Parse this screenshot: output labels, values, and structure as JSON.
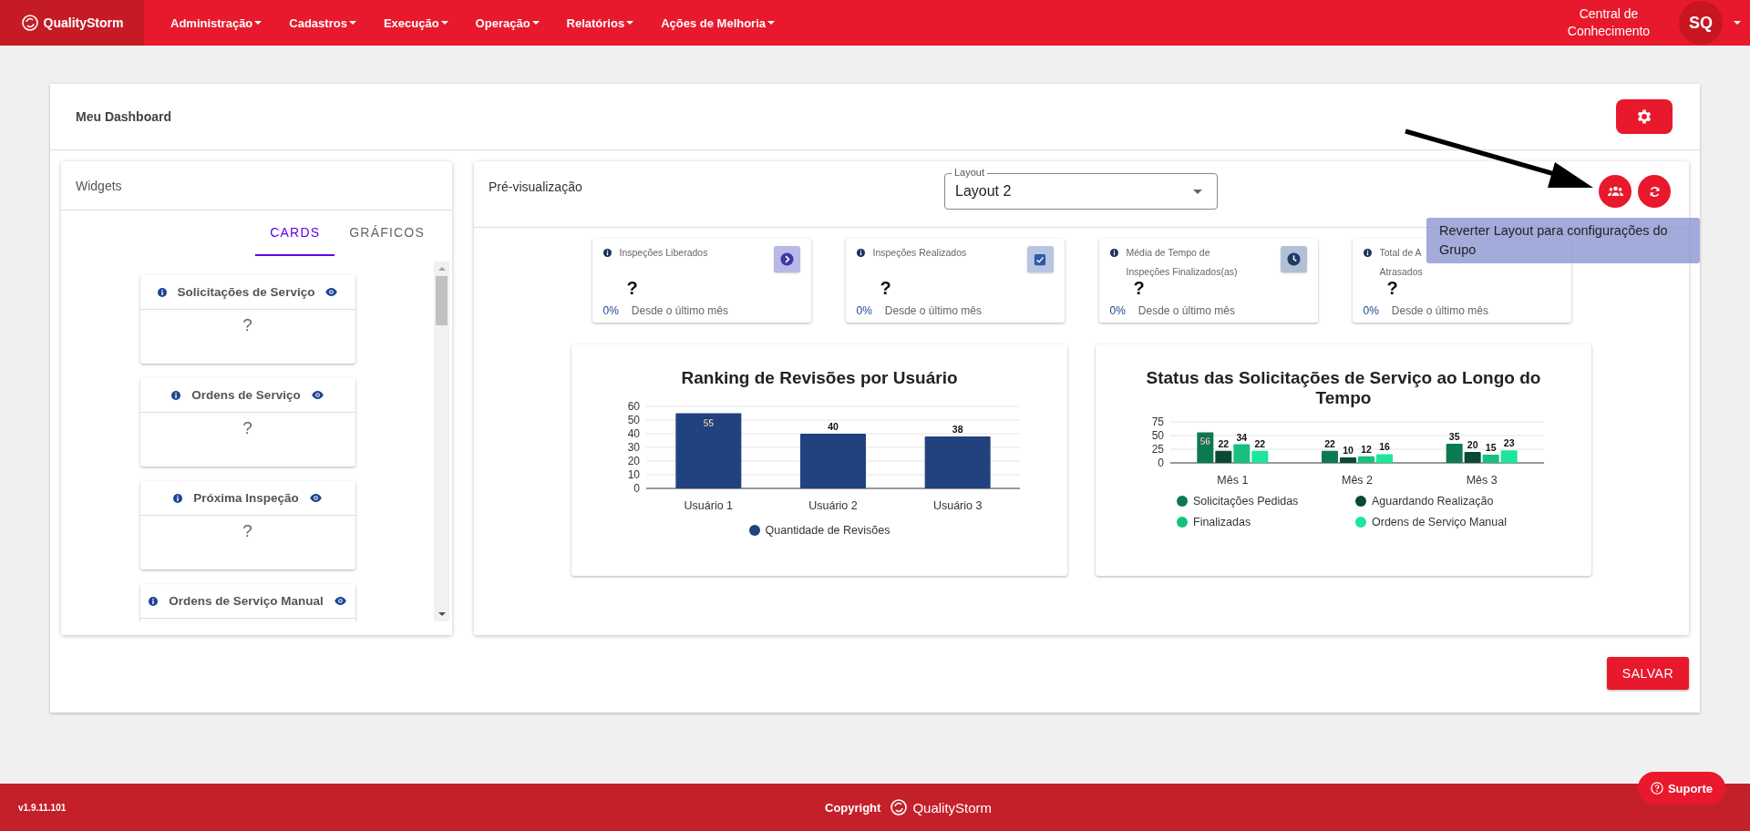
{
  "nav": {
    "brand": "QualityStorm",
    "menu": [
      "Administração",
      "Cadastros",
      "Execução",
      "Operação",
      "Relatórios",
      "Ações de Melhoria"
    ],
    "help_link": "Central de Conhecimento",
    "avatar": "SQ"
  },
  "page": {
    "title": "Meu Dashboard"
  },
  "widgets": {
    "title": "Widgets",
    "tabs": [
      {
        "label": "CARDS",
        "selected": true
      },
      {
        "label": "GRÁFICOS",
        "selected": false
      }
    ],
    "items": [
      {
        "title": "Solicitações de Serviço",
        "value": "?"
      },
      {
        "title": "Ordens de Serviço",
        "value": "?"
      },
      {
        "title": "Próxima Inspeção",
        "value": "?"
      },
      {
        "title": "Ordens de Serviço Manual"
      }
    ]
  },
  "preview": {
    "title": "Pré-visualização",
    "layout": {
      "label": "Layout",
      "value": "Layout 2"
    },
    "tooltip": "Reverter Layout para configurações do Grupo",
    "cards": [
      {
        "title": "Inspeções Liberados",
        "kind": "chevron",
        "value": "?",
        "change": "0%",
        "note": "Desde o último mês"
      },
      {
        "title": "Inspeções Realizados",
        "kind": "check",
        "value": "?",
        "change": "0%",
        "note": "Desde o último mês"
      },
      {
        "title": "Média de Tempo de Inspeções Finalizados(as)",
        "kind": "clock",
        "value": "?",
        "change": "0%",
        "note": "Desde o último mês"
      },
      {
        "title": "Total de A",
        "title_cont": "Atrasados",
        "value": "?",
        "change": "0%",
        "note": "Desde o último mês"
      }
    ],
    "charts": [
      {
        "chart_data": {
          "type": "bar",
          "title": "Ranking de Revisões por Usuário",
          "categories": [
            "Usuário 1",
            "Usuário 2",
            "Usuário 3"
          ],
          "ylim": [
            0,
            60
          ],
          "yticks": [
            0,
            10,
            20,
            30,
            40,
            50,
            60
          ],
          "data_labels": true,
          "grid": true,
          "legend": "bottom",
          "series": [
            {
              "name": "Quantidade de Revisões",
              "color": "#22427f",
              "values": [
                55,
                40,
                38
              ]
            }
          ]
        }
      },
      {
        "chart_data": {
          "type": "bar",
          "title": "Status das Solicitações de Serviço ao Longo do Tempo",
          "categories": [
            "Mês 1",
            "Mês 2",
            "Mês 3"
          ],
          "ylim": [
            0,
            75
          ],
          "yticks": [
            0,
            25,
            50,
            75
          ],
          "data_labels": true,
          "grid": true,
          "legend": "bottom",
          "series": [
            {
              "name": "Solicitações Pedidas",
              "color": "#0b7a50",
              "values": [
                56,
                22,
                35
              ]
            },
            {
              "name": "Aguardando Realização",
              "color": "#0a4a34",
              "values": [
                22,
                10,
                20
              ]
            },
            {
              "name": "Finalizadas",
              "color": "#17c07e",
              "values": [
                34,
                12,
                15
              ]
            },
            {
              "name": "Ordens de Serviço Manual",
              "color": "#1de59a",
              "values": [
                22,
                16,
                23
              ]
            }
          ]
        }
      }
    ]
  },
  "save": "SALVAR",
  "footer": {
    "version": "v1.9.11.101",
    "copyright": "Copyright",
    "brand": "QualityStorm",
    "support": "Suporte"
  }
}
